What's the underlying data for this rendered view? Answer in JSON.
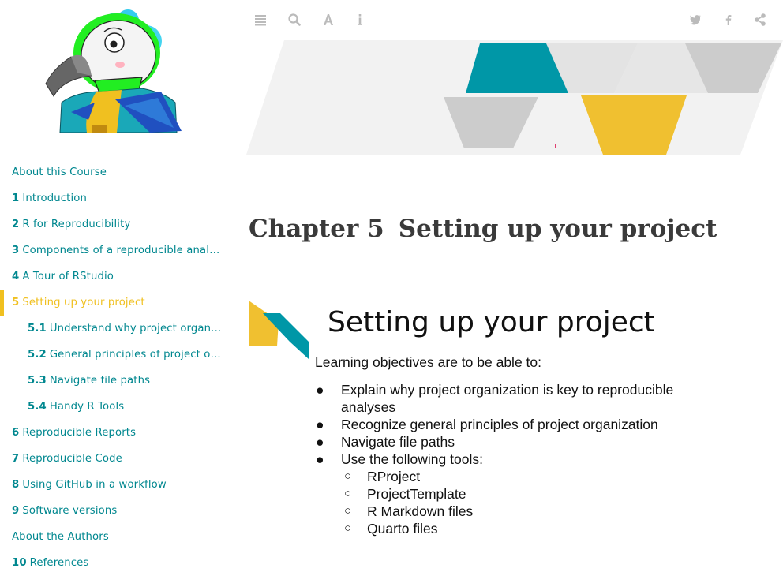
{
  "toolbar": {
    "left_icons": [
      "hamburger-icon",
      "search-icon",
      "font-icon",
      "info-icon"
    ],
    "right_icons": [
      "twitter-icon",
      "facebook-icon",
      "share-icon"
    ],
    "icon_color": "#bbbbbb"
  },
  "colors": {
    "link": "#00878f",
    "active": "#f0c020",
    "teal": "#0097a7",
    "yellow": "#f0c030",
    "gray": "#cccccc"
  },
  "toc": [
    {
      "num": "",
      "label": "About this Course",
      "level": 1,
      "active": false
    },
    {
      "num": "1",
      "label": "Introduction",
      "level": 1,
      "active": false
    },
    {
      "num": "2",
      "label": "R for Reproducibility",
      "level": 1,
      "active": false
    },
    {
      "num": "3",
      "label": "Components of a reproducible analysis",
      "level": 1,
      "active": false
    },
    {
      "num": "4",
      "label": "A Tour of RStudio",
      "level": 1,
      "active": false
    },
    {
      "num": "5",
      "label": "Setting up your project",
      "level": 1,
      "active": true
    },
    {
      "num": "5.1",
      "label": "Understand why project organization is key to reproducible analyses",
      "level": 2,
      "active": false
    },
    {
      "num": "5.2",
      "label": "General principles of project organization",
      "level": 2,
      "active": false
    },
    {
      "num": "5.3",
      "label": "Navigate file paths",
      "level": 2,
      "active": false
    },
    {
      "num": "5.4",
      "label": "Handy R Tools",
      "level": 2,
      "active": false
    },
    {
      "num": "6",
      "label": "Reproducible Reports",
      "level": 1,
      "active": false
    },
    {
      "num": "7",
      "label": "Reproducible Code",
      "level": 1,
      "active": false
    },
    {
      "num": "8",
      "label": "Using GitHub in a workflow",
      "level": 1,
      "active": false
    },
    {
      "num": "9",
      "label": "Software versions",
      "level": 1,
      "active": false
    },
    {
      "num": "",
      "label": "About the Authors",
      "level": 1,
      "active": false
    },
    {
      "num": "10",
      "label": "References",
      "level": 1,
      "active": false
    }
  ],
  "chapter": {
    "number": "Chapter 5",
    "title": "Setting up your project"
  },
  "slide": {
    "title": "Setting up your project",
    "subtitle": "Learning objectives are to be able to:",
    "bullet_1": "Explain why project organization is key to reproducible analyses",
    "bullet_2": "Recognize general principles of project organization",
    "bullet_3": "Navigate file paths",
    "bullet_4": "Use the following tools:",
    "sub_1": "RProject",
    "sub_2": "ProjectTemplate",
    "sub_3": "R Markdown files",
    "sub_4": "Quarto files",
    "bullet_symbol": "●",
    "sub_symbol": "○"
  }
}
